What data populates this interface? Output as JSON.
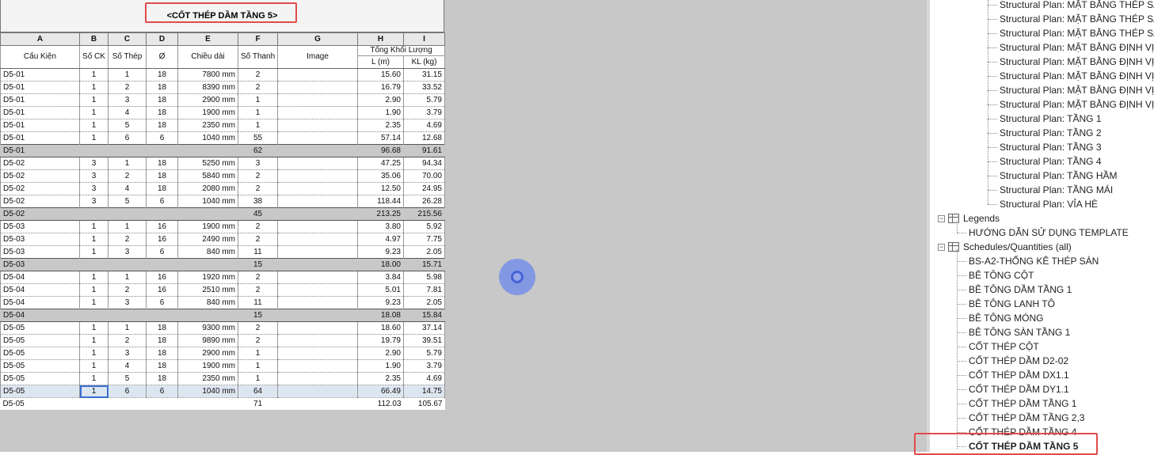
{
  "schedule": {
    "title": "<CỐT THÉP DẦM TẦNG 5>",
    "column_letters": [
      "A",
      "B",
      "C",
      "D",
      "E",
      "F",
      "G",
      "H",
      "I"
    ],
    "headers": {
      "cau_kien": "Cấu Kiện",
      "so_ck": "Số CK",
      "so_thep": "Số Thép",
      "phi": "Ø",
      "chieu_dai": "Chiều dài",
      "so_thanh": "Số Thanh",
      "image": "Image",
      "tong_khoi_luong": "Tổng Khối Lượng",
      "l_m": "L (m)",
      "kl_kg": "KL (kg)"
    },
    "rows": [
      {
        "type": "data",
        "a": "D5-01",
        "b": "1",
        "c": "1",
        "d": "18",
        "e": "7800 mm",
        "f": "2",
        "g": "",
        "h": "15.60",
        "i": "31.15"
      },
      {
        "type": "data",
        "a": "D5-01",
        "b": "1",
        "c": "2",
        "d": "18",
        "e": "8390 mm",
        "f": "2",
        "g": "",
        "h": "16.79",
        "i": "33.52"
      },
      {
        "type": "data",
        "a": "D5-01",
        "b": "1",
        "c": "3",
        "d": "18",
        "e": "2900 mm",
        "f": "1",
        "g": "",
        "h": "2.90",
        "i": "5.79"
      },
      {
        "type": "data",
        "a": "D5-01",
        "b": "1",
        "c": "4",
        "d": "18",
        "e": "1900 mm",
        "f": "1",
        "g": "",
        "h": "1.90",
        "i": "3.79"
      },
      {
        "type": "data",
        "a": "D5-01",
        "b": "1",
        "c": "5",
        "d": "18",
        "e": "2350 mm",
        "f": "1",
        "g": "",
        "h": "2.35",
        "i": "4.69"
      },
      {
        "type": "data",
        "a": "D5-01",
        "b": "1",
        "c": "6",
        "d": "6",
        "e": "1040 mm",
        "f": "55",
        "g": "",
        "h": "57.14",
        "i": "12.68"
      },
      {
        "type": "sub",
        "a": "D5-01",
        "b": "",
        "c": "",
        "d": "",
        "e": "",
        "f": "62",
        "g": "",
        "h": "96.68",
        "i": "91.61"
      },
      {
        "type": "data",
        "a": "D5-02",
        "b": "3",
        "c": "1",
        "d": "18",
        "e": "5250 mm",
        "f": "3",
        "g": "",
        "h": "47.25",
        "i": "94.34"
      },
      {
        "type": "data",
        "a": "D5-02",
        "b": "3",
        "c": "2",
        "d": "18",
        "e": "5840 mm",
        "f": "2",
        "g": "",
        "h": "35.06",
        "i": "70.00"
      },
      {
        "type": "data",
        "a": "D5-02",
        "b": "3",
        "c": "4",
        "d": "18",
        "e": "2080 mm",
        "f": "2",
        "g": "",
        "h": "12.50",
        "i": "24.95"
      },
      {
        "type": "data",
        "a": "D5-02",
        "b": "3",
        "c": "5",
        "d": "6",
        "e": "1040 mm",
        "f": "38",
        "g": "",
        "h": "118.44",
        "i": "26.28"
      },
      {
        "type": "sub",
        "a": "D5-02",
        "b": "",
        "c": "",
        "d": "",
        "e": "",
        "f": "45",
        "g": "",
        "h": "213.25",
        "i": "215.56"
      },
      {
        "type": "data",
        "a": "D5-03",
        "b": "1",
        "c": "1",
        "d": "16",
        "e": "1900 mm",
        "f": "2",
        "g": "",
        "h": "3.80",
        "i": "5.92"
      },
      {
        "type": "data",
        "a": "D5-03",
        "b": "1",
        "c": "2",
        "d": "16",
        "e": "2490 mm",
        "f": "2",
        "g": "",
        "h": "4.97",
        "i": "7.75"
      },
      {
        "type": "data",
        "a": "D5-03",
        "b": "1",
        "c": "3",
        "d": "6",
        "e": "840 mm",
        "f": "11",
        "g": "",
        "h": "9.23",
        "i": "2.05"
      },
      {
        "type": "sub",
        "a": "D5-03",
        "b": "",
        "c": "",
        "d": "",
        "e": "",
        "f": "15",
        "g": "",
        "h": "18.00",
        "i": "15.71"
      },
      {
        "type": "data",
        "a": "D5-04",
        "b": "1",
        "c": "1",
        "d": "16",
        "e": "1920 mm",
        "f": "2",
        "g": "",
        "h": "3.84",
        "i": "5.98"
      },
      {
        "type": "data",
        "a": "D5-04",
        "b": "1",
        "c": "2",
        "d": "16",
        "e": "2510 mm",
        "f": "2",
        "g": "",
        "h": "5.01",
        "i": "7.81"
      },
      {
        "type": "data",
        "a": "D5-04",
        "b": "1",
        "c": "3",
        "d": "6",
        "e": "840 mm",
        "f": "11",
        "g": "",
        "h": "9.23",
        "i": "2.05"
      },
      {
        "type": "sub",
        "a": "D5-04",
        "b": "",
        "c": "",
        "d": "",
        "e": "",
        "f": "15",
        "g": "",
        "h": "18.08",
        "i": "15.84"
      },
      {
        "type": "data",
        "a": "D5-05",
        "b": "1",
        "c": "1",
        "d": "18",
        "e": "9300 mm",
        "f": "2",
        "g": "",
        "h": "18.60",
        "i": "37.14"
      },
      {
        "type": "data",
        "a": "D5-05",
        "b": "1",
        "c": "2",
        "d": "18",
        "e": "9890 mm",
        "f": "2",
        "g": "",
        "h": "19.79",
        "i": "39.51"
      },
      {
        "type": "data",
        "a": "D5-05",
        "b": "1",
        "c": "3",
        "d": "18",
        "e": "2900 mm",
        "f": "1",
        "g": "",
        "h": "2.90",
        "i": "5.79"
      },
      {
        "type": "data",
        "a": "D5-05",
        "b": "1",
        "c": "4",
        "d": "18",
        "e": "1900 mm",
        "f": "1",
        "g": "",
        "h": "1.90",
        "i": "3.79"
      },
      {
        "type": "data",
        "a": "D5-05",
        "b": "1",
        "c": "5",
        "d": "18",
        "e": "2350 mm",
        "f": "1",
        "g": "",
        "h": "2.35",
        "i": "4.69"
      },
      {
        "type": "data",
        "selected": true,
        "a": "D5-05",
        "b": "1",
        "c": "6",
        "d": "6",
        "e": "1040 mm",
        "f": "64",
        "g": "",
        "h": "66.49",
        "i": "14.75"
      },
      {
        "type": "grand",
        "a": "D5-05",
        "b": "",
        "c": "",
        "d": "",
        "e": "",
        "f": "71",
        "g": "",
        "h": "112.03",
        "i": "105.67"
      }
    ]
  },
  "browser": {
    "structural_plans": [
      "Structural Plan: MẶT BẰNG THÉP SÀN",
      "Structural Plan: MẶT BẰNG THÉP SÀN",
      "Structural Plan: MẶT BẰNG THÉP SÀN",
      "Structural Plan: MẶT BẰNG ĐỊNH VỊ C",
      "Structural Plan: MẶT BẰNG ĐỊNH VỊ C",
      "Structural Plan: MẶT BẰNG ĐỊNH VỊ C",
      "Structural Plan: MẶT BẰNG ĐỊNH VỊ C",
      "Structural Plan: MẶT BẰNG ĐỊNH VỊ C",
      "Structural Plan: TẦNG 1",
      "Structural Plan: TẦNG 2",
      "Structural Plan: TẦNG 3",
      "Structural Plan: TẦNG 4",
      "Structural Plan: TẦNG HẦM",
      "Structural Plan: TẦNG MÁI",
      "Structural Plan: VỈA HÈ"
    ],
    "legends_label": "Legends",
    "legends_items": [
      "HƯỚNG DẪN SỬ DỤNG TEMPLATE"
    ],
    "schedules_label": "Schedules/Quantities (all)",
    "schedules_items": [
      "BS-A2-THỐNG KÊ THÉP SÀN",
      "BÊ TÔNG CỘT",
      "BÊ TÔNG DẦM TẦNG 1",
      "BÊ TÔNG LANH TÔ",
      "BÊ TÔNG MÓNG",
      "BÊ TÔNG SÀN TẦNG 1",
      "CỐT THÉP CỘT",
      "CỐT THÉP DẦM D2-02",
      "CỐT THÉP DẦM DX1.1",
      "CỐT THÉP DẦM DY1.1",
      "CỐT THÉP DẦM TẦNG 1",
      "CỐT THÉP DẦM TẦNG 2,3",
      "CỐT THÉP DẦM TẦNG 4",
      "CỐT THÉP DẦM TẦNG 5"
    ],
    "selected_item": "CỐT THÉP DẦM TẦNG 5",
    "toggle_symbol": "−"
  },
  "colors": {
    "highlight": "#e14b4b",
    "selection": "#3a6fcf",
    "cursor": "#7b93e6"
  }
}
